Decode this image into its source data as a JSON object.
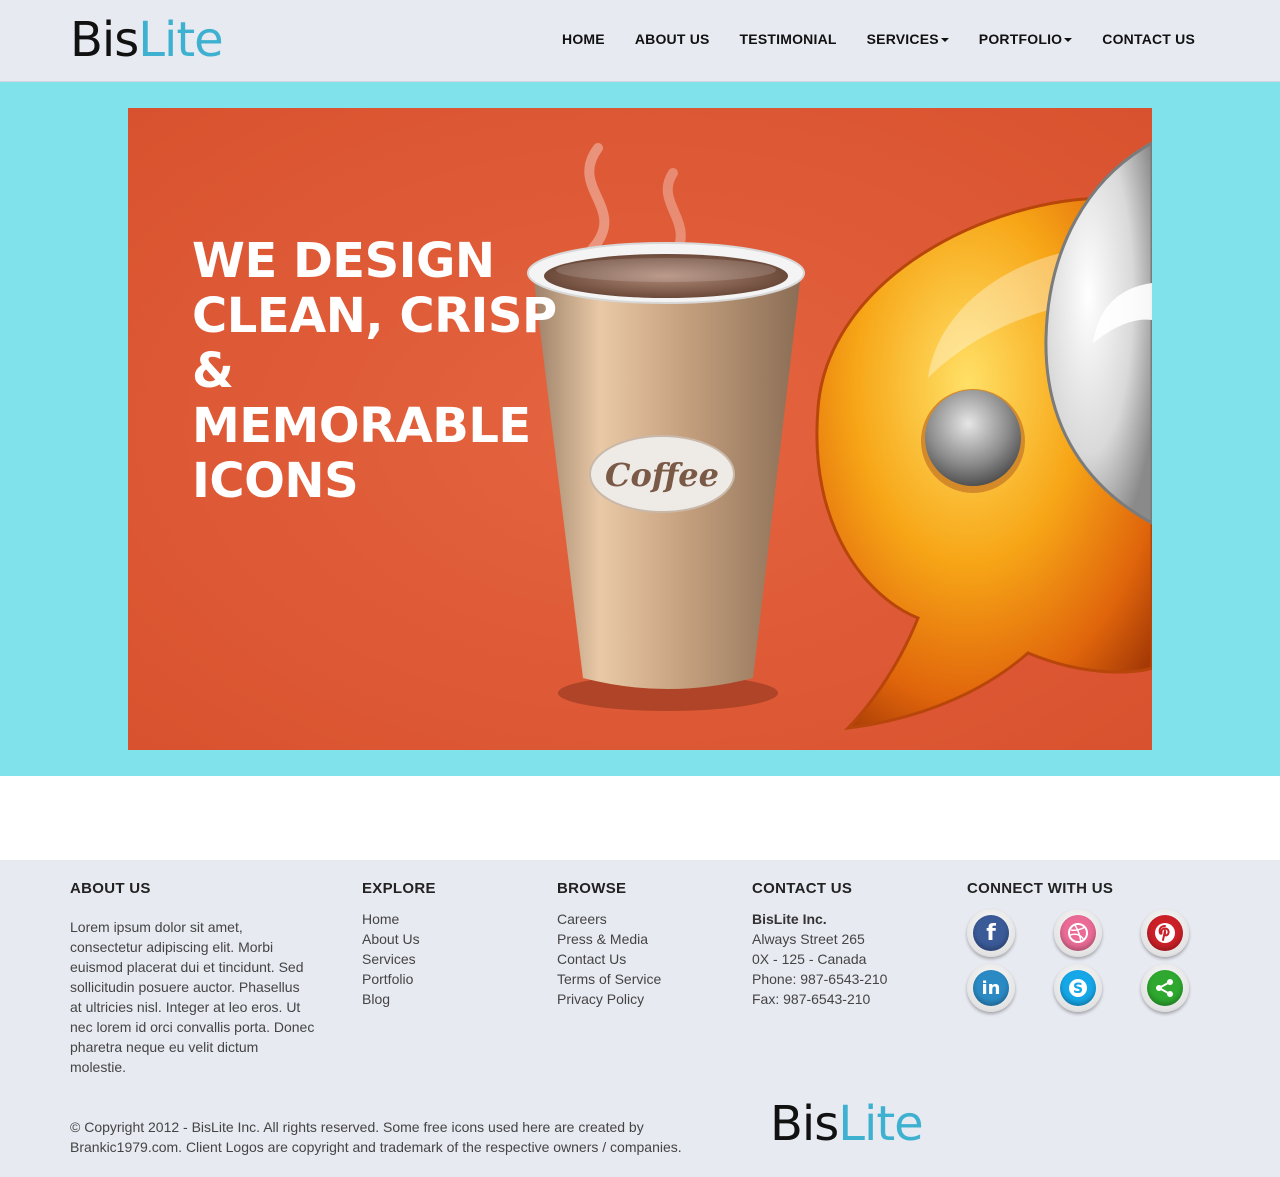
{
  "brand": {
    "part1": "Bis",
    "part2": "Lite"
  },
  "nav": {
    "items": [
      {
        "label": "HOME",
        "dropdown": false
      },
      {
        "label": "ABOUT US",
        "dropdown": false
      },
      {
        "label": "TESTIMONIAL",
        "dropdown": false
      },
      {
        "label": "SERVICES",
        "dropdown": true
      },
      {
        "label": "PORTFOLIO",
        "dropdown": true
      },
      {
        "label": "CONTACT US",
        "dropdown": false
      }
    ]
  },
  "hero": {
    "headline_lines": [
      "WE DESIGN",
      "CLEAN, CRISP &",
      "MEMORABLE",
      "ICONS"
    ],
    "cup_label": "Coffee",
    "background_color": "#e0583a",
    "band_color": "#80e3ec"
  },
  "footer": {
    "about": {
      "heading": "ABOUT US",
      "text": "Lorem ipsum dolor sit amet, consectetur adipiscing elit. Morbi euismod placerat dui et tincidunt. Sed sollicitudin posuere auctor. Phasellus at ultricies nisl. Integer at leo eros. Ut nec lorem id orci convallis porta. Donec pharetra neque eu velit dictum molestie."
    },
    "explore": {
      "heading": "EXPLORE",
      "links": [
        "Home",
        "About Us",
        "Services",
        "Portfolio",
        "Blog"
      ]
    },
    "browse": {
      "heading": "BROWSE",
      "links": [
        "Careers",
        "Press & Media",
        "Contact Us",
        "Terms of Service",
        "Privacy Policy"
      ]
    },
    "contact": {
      "heading": "CONTACT US",
      "company": "BisLite Inc.",
      "street": "Always Street 265",
      "city": "0X - 125 - Canada",
      "phone": "Phone: 987-6543-210",
      "fax": "Fax: 987-6543-210"
    },
    "social": {
      "heading": "CONNECT WITH US",
      "icons": [
        {
          "name": "facebook-icon",
          "glyph": "f",
          "color": "#3a5a98"
        },
        {
          "name": "dribbble-icon",
          "glyph": "⊛",
          "color": "#e96b96"
        },
        {
          "name": "pinterest-icon",
          "glyph": "P",
          "color": "#cb2027"
        },
        {
          "name": "linkedin-icon",
          "glyph": "in",
          "color": "#2b8ac4"
        },
        {
          "name": "skype-icon",
          "glyph": "S",
          "color": "#16a7e8"
        },
        {
          "name": "share-icon",
          "glyph": "<",
          "color": "#2ea82e"
        }
      ]
    },
    "copyright": "© Copyright 2012 - BisLite Inc. All rights reserved. Some free icons used here are created by Brankic1979.com. Client Logos are copyright and trademark of the respective owners / companies."
  }
}
